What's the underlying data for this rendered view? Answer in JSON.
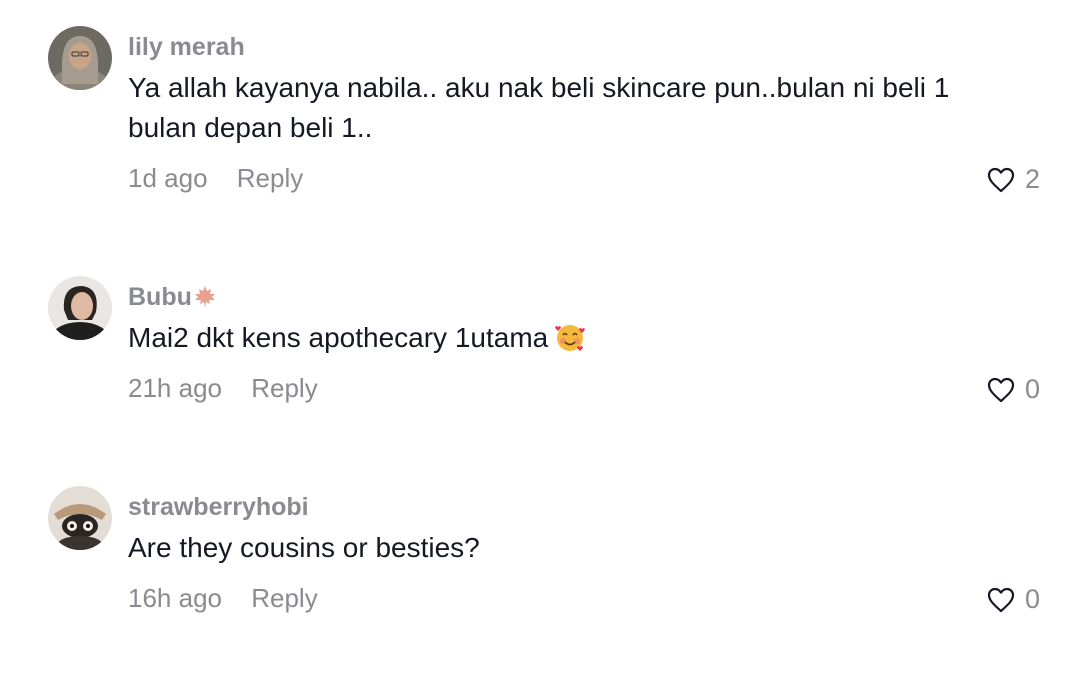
{
  "comments": [
    {
      "username": "lily merah",
      "text": "Ya allah kayanya nabila.. aku nak beli skincare pun..bulan ni beli 1 bulan depan beli 1..",
      "time": "1d ago",
      "reply_label": "Reply",
      "likes": "2",
      "like_icon": "heart-outline-icon"
    },
    {
      "username": "Bubu",
      "username_emoji": "maple-leaf-emoji",
      "text": "Mai2 dkt kens apothecary 1utama",
      "text_emoji": "smiling-face-with-hearts-emoji",
      "time": "21h ago",
      "reply_label": "Reply",
      "likes": "0",
      "like_icon": "heart-outline-icon"
    },
    {
      "username": "strawberryhobi",
      "text": "Are they cousins or besties?",
      "time": "16h ago",
      "reply_label": "Reply",
      "likes": "0",
      "like_icon": "heart-outline-icon"
    }
  ],
  "colors": {
    "secondary_text": "#8a8b91",
    "primary_text": "#161823",
    "background": "#ffffff"
  }
}
